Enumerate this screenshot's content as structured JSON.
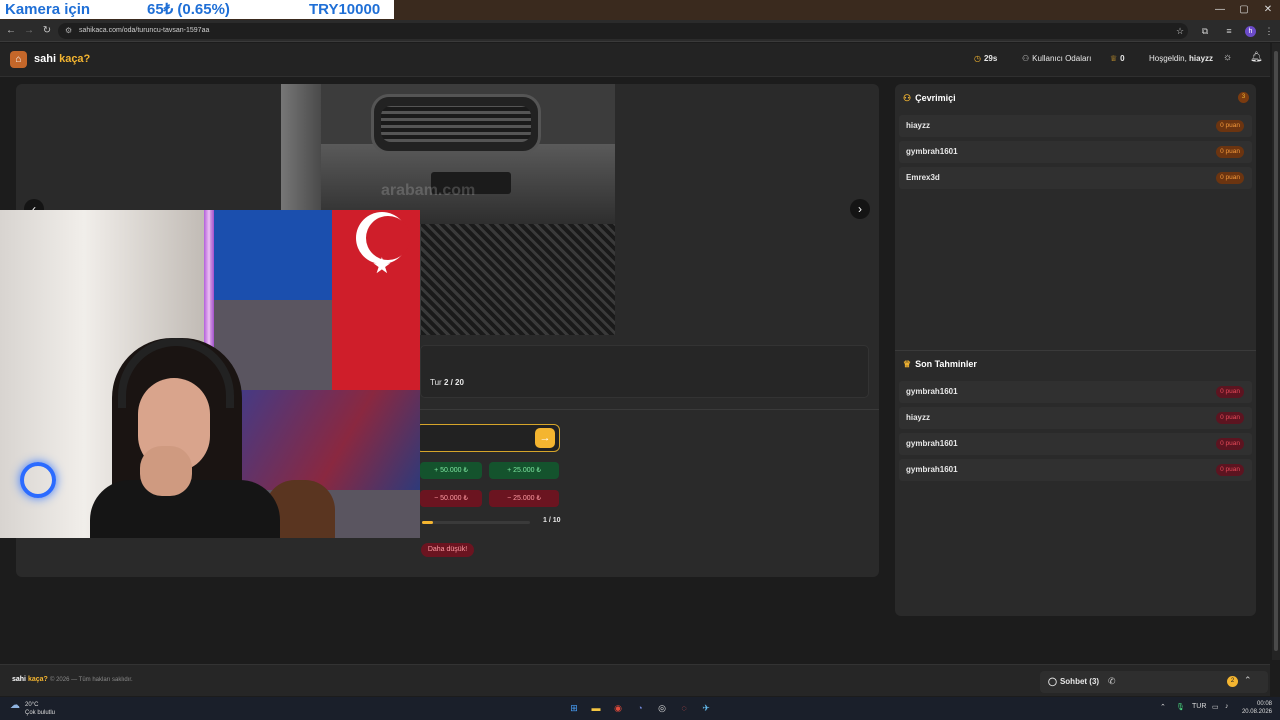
{
  "overlay_banner": {
    "left": "Kamera için",
    "middle": "65₺ (0.65%)",
    "right": "TRY10000"
  },
  "browser": {
    "url": "sahikaca.com/oda/turuncu-tavsan-1597aa",
    "profile_initial": "h",
    "window_controls": [
      "—",
      "▢",
      "✕"
    ]
  },
  "header": {
    "logo_main": "sahi",
    "logo_accent": "kaça?",
    "timer": "29s",
    "user_rooms": "Kullanıcı Odaları",
    "score": "0",
    "welcome_prefix": "Hoşgeldin,",
    "username": "hiayzz"
  },
  "game": {
    "photo_watermark": "arabam.com",
    "round_label": "Tur",
    "round_value": "2 / 20",
    "submit_icon": "→",
    "chips": {
      "plus_50": "+ 50.000 ₺",
      "plus_25": "+ 25.000 ₺",
      "minus_50": "− 50.000 ₺",
      "minus_25": "− 25.000 ₺"
    },
    "attempts": "1 / 10",
    "attempts_fraction": 0.1,
    "hint": "Daha düşük!"
  },
  "online": {
    "title": "Çevrimiçi",
    "count": "3",
    "players": [
      {
        "name": "hiayzz",
        "points": "0 puan"
      },
      {
        "name": "gymbrah1601",
        "points": "0 puan"
      },
      {
        "name": "Emrex3d",
        "points": "0 puan"
      }
    ]
  },
  "recent": {
    "title": "Son Tahminler",
    "guesses": [
      {
        "name": "gymbrah1601",
        "points": "0 puan"
      },
      {
        "name": "hiayzz",
        "points": "0 puan"
      },
      {
        "name": "gymbrah1601",
        "points": "0 puan"
      },
      {
        "name": "gymbrah1601",
        "points": "0 puan"
      }
    ]
  },
  "footer": {
    "logo_main": "sahi",
    "logo_accent": "kaça?",
    "copyright": "© 2026 — Tüm hakları saklıdır.",
    "chat_label": "Sohbet (3)",
    "chat_badge": "2"
  },
  "taskbar": {
    "temp": "20°C",
    "weather": "Çok bulutlu",
    "lang": "TUR",
    "time": "00:08",
    "date": "20.08.2026"
  },
  "colors": {
    "accent": "#f4b530",
    "brand_orange": "#c4672a",
    "positive": "#14532d",
    "negative": "#6b1420"
  }
}
